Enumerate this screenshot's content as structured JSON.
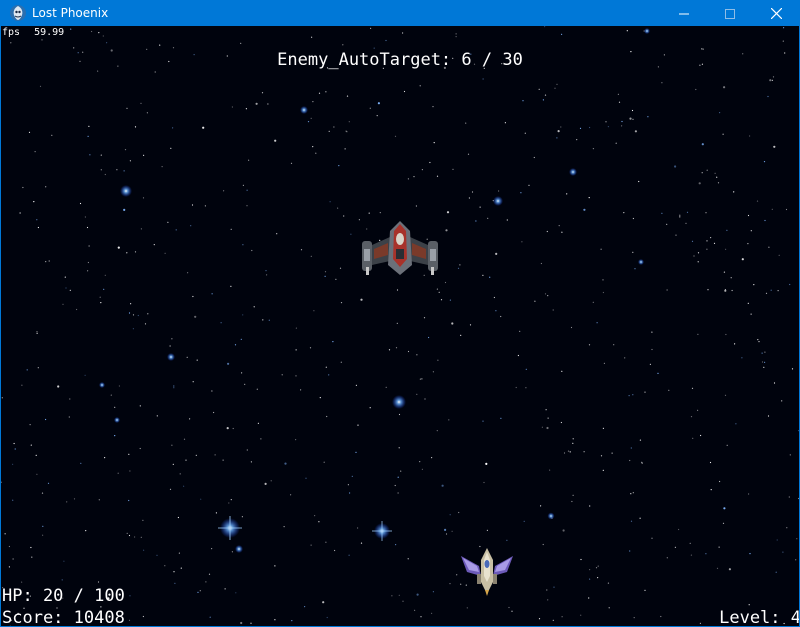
{
  "window": {
    "title": "Lost Phoenix",
    "icon": "phoenix-app-icon",
    "controls": [
      "minimize-icon",
      "maximize-icon",
      "close-icon"
    ],
    "accent_color": "#0078d7"
  },
  "hud": {
    "fps_label": "fps",
    "fps_value": "59.99",
    "target_counter": "Enemy_AutoTarget: 6 / 30",
    "hp": "HP: 20 / 100",
    "score": "Score: 10408",
    "level": "Level: 4"
  },
  "scene": {
    "background_color": "#00030d",
    "enemy_ship": "enemy-fighter-ship",
    "player_ship": "player-phoenix-ship"
  }
}
